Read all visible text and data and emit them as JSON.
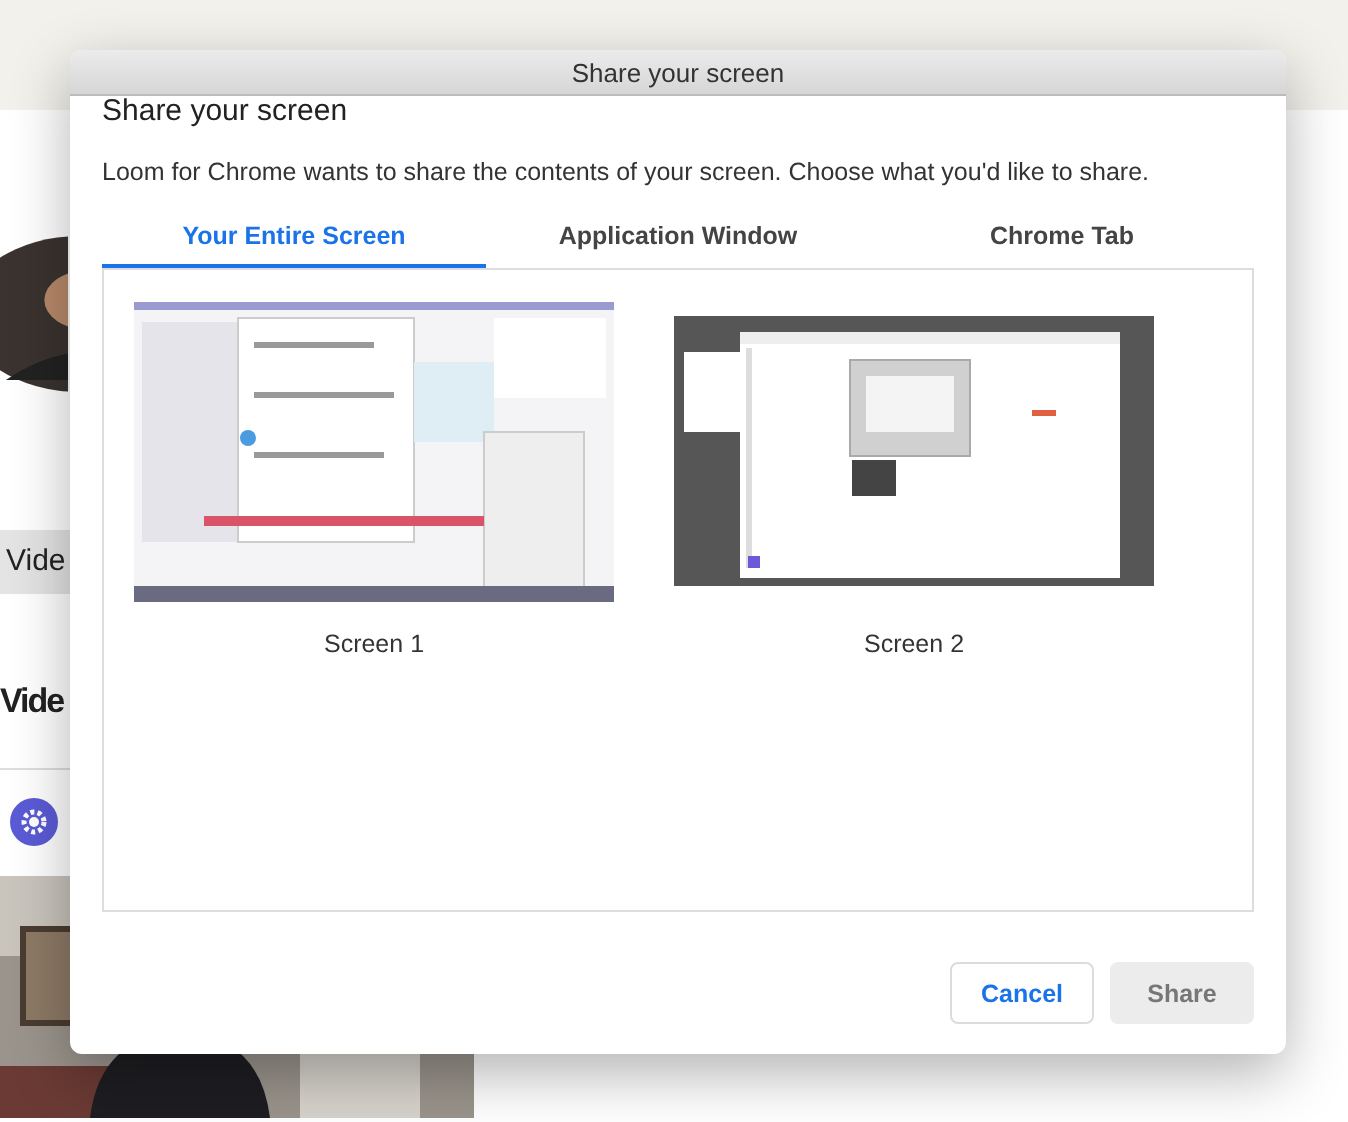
{
  "background_page": {
    "button": "Vide",
    "heading": "Vide"
  },
  "dialog": {
    "window_title": "Share your screen",
    "heading": "Share your screen",
    "description": "Loom for Chrome wants to share the contents of your screen. Choose what you'd like to share.",
    "tabs": [
      {
        "label": "Your Entire Screen",
        "selected": true
      },
      {
        "label": "Application Window",
        "selected": false
      },
      {
        "label": "Chrome Tab",
        "selected": false
      }
    ],
    "sources": [
      {
        "label": "Screen 1",
        "kind": "light",
        "selected": false
      },
      {
        "label": "Screen 2",
        "kind": "dark",
        "selected": false
      }
    ],
    "buttons": [
      {
        "label": "Cancel",
        "disabled": false
      },
      {
        "label": "Share",
        "disabled": true
      }
    ]
  }
}
